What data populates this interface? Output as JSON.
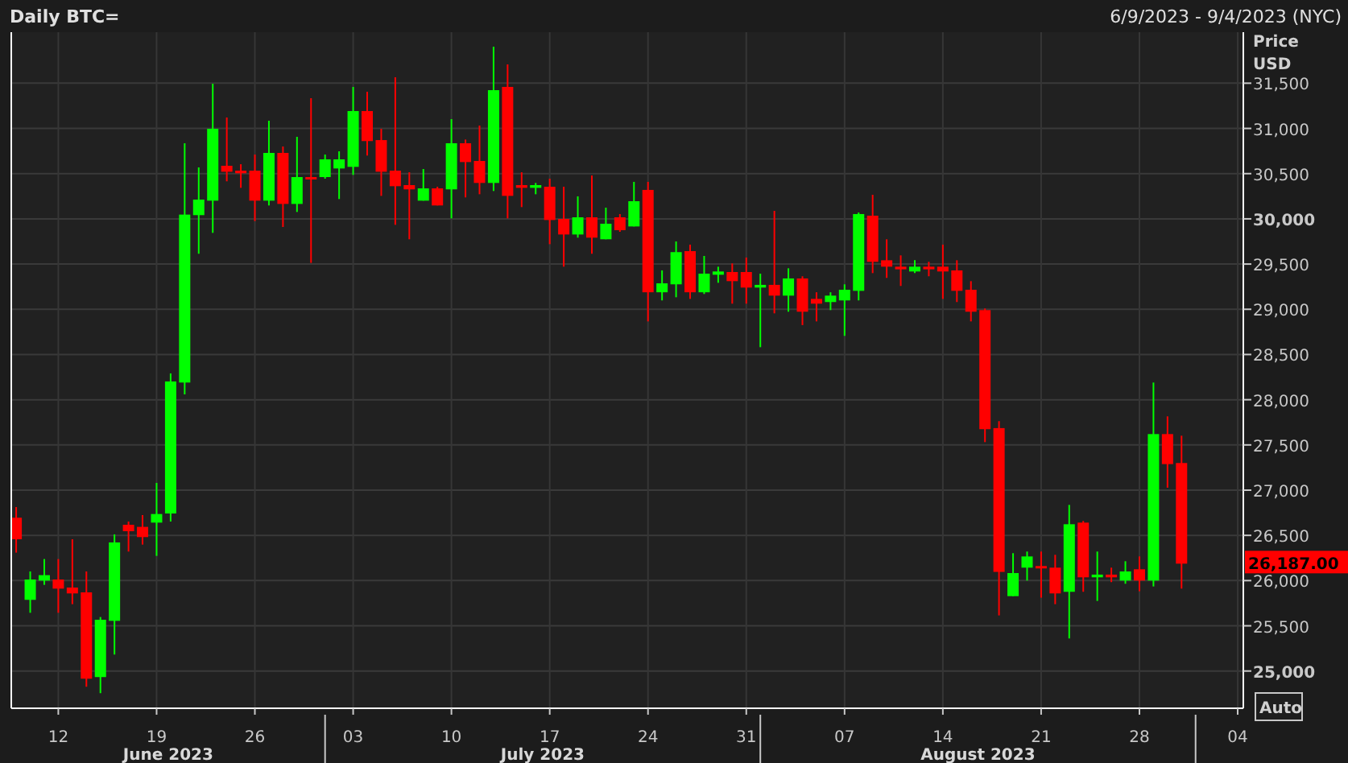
{
  "header": {
    "title": "Daily BTC=",
    "range": "6/9/2023 - 9/4/2023 (NYC)"
  },
  "chart": {
    "chart_data": {
      "type": "candlestick",
      "grid": true,
      "categories": [
        null,
        null,
        null,
        "12",
        null,
        null,
        null,
        null,
        null,
        null,
        "19",
        null,
        null,
        null,
        null,
        null,
        null,
        "26",
        null,
        null,
        null,
        null,
        null,
        null,
        "03",
        null,
        null,
        null,
        null,
        null,
        null,
        "10",
        null,
        null,
        null,
        null,
        null,
        null,
        "17",
        null,
        null,
        null,
        null,
        null,
        null,
        "24",
        null,
        null,
        null,
        null,
        null,
        null,
        "31",
        null,
        null,
        null,
        null,
        null,
        null,
        "07",
        null,
        null,
        null,
        null,
        null,
        null,
        "14",
        null,
        null,
        null,
        null,
        null,
        null,
        "21",
        null,
        null,
        null,
        null,
        null,
        null,
        "28",
        null,
        null,
        null,
        null,
        null,
        null,
        "04"
      ],
      "ohlc": [
        [
          26695,
          26813,
          26309,
          26457
        ],
        [
          25787,
          26101,
          25644,
          26012
        ],
        [
          26000,
          26238,
          25953,
          26060
        ],
        [
          26012,
          26238,
          25644,
          25911
        ],
        [
          25923,
          26457,
          25739,
          25858
        ],
        [
          25870,
          26101,
          24826,
          24915
        ],
        [
          24933,
          25597,
          24755,
          25567
        ],
        [
          25555,
          26511,
          25182,
          26422
        ],
        [
          26617,
          26653,
          26321,
          26546
        ],
        [
          26594,
          26724,
          26398,
          26481
        ],
        [
          26641,
          27080,
          26273,
          26736
        ],
        [
          26742,
          28291,
          26653,
          28202
        ],
        [
          28190,
          30836,
          28059,
          30047
        ],
        [
          30041,
          30569,
          29614,
          30213
        ],
        [
          30201,
          31494,
          29845,
          30996
        ],
        [
          30587,
          31121,
          30415,
          30521
        ],
        [
          30533,
          30604,
          30343,
          30504
        ],
        [
          30533,
          30711,
          29976,
          30201
        ],
        [
          30201,
          31085,
          30148,
          30729
        ],
        [
          30729,
          30800,
          29910,
          30165
        ],
        [
          30165,
          30907,
          30076,
          30462
        ],
        [
          30462,
          31334,
          29513,
          30438
        ],
        [
          30462,
          30711,
          30444,
          30658
        ],
        [
          30557,
          30747,
          30219,
          30658
        ],
        [
          30575,
          31459,
          30486,
          31192
        ],
        [
          31192,
          31405,
          30700,
          30860
        ],
        [
          30871,
          30996,
          30254,
          30521
        ],
        [
          30533,
          31566,
          29934,
          30361
        ],
        [
          30373,
          30515,
          29774,
          30326
        ],
        [
          30201,
          30551,
          30201,
          30337
        ],
        [
          30337,
          30355,
          30148,
          30148
        ],
        [
          30326,
          31103,
          30005,
          30836
        ],
        [
          30836,
          30877,
          30237,
          30628
        ],
        [
          30640,
          31032,
          30272,
          30397
        ],
        [
          30397,
          31904,
          30308,
          31423
        ],
        [
          31459,
          31708,
          30005,
          30254
        ],
        [
          30373,
          30515,
          30130,
          30343
        ],
        [
          30343,
          30397,
          30272,
          30373
        ],
        [
          30355,
          30444,
          29720,
          29987
        ],
        [
          29999,
          30355,
          29471,
          29827
        ],
        [
          29827,
          30249,
          29792,
          30017
        ],
        [
          30017,
          30480,
          29614,
          29792
        ],
        [
          29774,
          30124,
          29774,
          29946
        ],
        [
          30017,
          30053,
          29857,
          29875
        ],
        [
          29916,
          30409,
          29916,
          30195
        ],
        [
          30320,
          30409,
          28866,
          29188
        ],
        [
          29188,
          29430,
          29098,
          29287
        ],
        [
          29276,
          29750,
          29133,
          29632
        ],
        [
          29643,
          29715,
          29115,
          29188
        ],
        [
          29188,
          29590,
          29169,
          29394
        ],
        [
          29382,
          29471,
          29293,
          29418
        ],
        [
          29412,
          29507,
          29062,
          29311
        ],
        [
          29412,
          29572,
          29062,
          29240
        ],
        [
          29240,
          29394,
          28581,
          29270
        ],
        [
          29270,
          30088,
          28955,
          29151
        ],
        [
          29151,
          29453,
          28973,
          29341
        ],
        [
          29341,
          29365,
          28825,
          28973
        ],
        [
          29115,
          29188,
          28866,
          29062
        ],
        [
          29080,
          29188,
          28991,
          29151
        ],
        [
          29098,
          29276,
          28706,
          29216
        ],
        [
          29204,
          30070,
          29098,
          30053
        ],
        [
          30035,
          30266,
          29400,
          29525
        ],
        [
          29542,
          29774,
          29347,
          29471
        ],
        [
          29471,
          29596,
          29258,
          29442
        ],
        [
          29418,
          29542,
          29400,
          29471
        ],
        [
          29471,
          29525,
          29365,
          29442
        ],
        [
          29471,
          29715,
          29115,
          29418
        ],
        [
          29430,
          29542,
          29080,
          29204
        ],
        [
          29216,
          29311,
          28866,
          28973
        ],
        [
          28991,
          29009,
          27531,
          27674
        ],
        [
          27686,
          27763,
          25615,
          26096
        ],
        [
          25828,
          26303,
          25828,
          26083
        ],
        [
          26143,
          26321,
          26000,
          26267
        ],
        [
          26161,
          26321,
          25811,
          26143
        ],
        [
          26143,
          26285,
          25739,
          25858
        ],
        [
          25876,
          26837,
          25360,
          26623
        ],
        [
          26641,
          26659,
          25876,
          26036
        ],
        [
          26036,
          26321,
          25775,
          26066
        ],
        [
          26066,
          26143,
          25983,
          26036
        ],
        [
          26000,
          26214,
          25965,
          26101
        ],
        [
          26125,
          26267,
          25882,
          26000
        ],
        [
          26000,
          28190,
          25935,
          27620
        ],
        [
          27620,
          27816,
          27027,
          27288
        ],
        [
          27300,
          27602,
          25911,
          26187
        ],
        null,
        null,
        null,
        null
      ],
      "ylim": [
        24588,
        32064
      ],
      "yticks": [
        {
          "value": 25000,
          "label": "25,000"
        },
        {
          "value": 25500,
          "label": "25,500"
        },
        {
          "value": 26000,
          "label": "26,000"
        },
        {
          "value": 26500,
          "label": "26,500"
        },
        {
          "value": 27000,
          "label": "27,000"
        },
        {
          "value": 27500,
          "label": "27,500"
        },
        {
          "value": 28000,
          "label": "28,000"
        },
        {
          "value": 28500,
          "label": "28,500"
        },
        {
          "value": 29000,
          "label": "29,000"
        },
        {
          "value": 29500,
          "label": "29,500"
        },
        {
          "value": 30000,
          "label": "30,000"
        },
        {
          "value": 30500,
          "label": "30,500"
        },
        {
          "value": 31000,
          "label": "31,000"
        },
        {
          "value": 31500,
          "label": "31,500"
        }
      ]
    },
    "axis_title": [
      "Price",
      "USD"
    ],
    "current_price": "26,187.00",
    "auto_button": "Auto",
    "months": [
      {
        "label": "June 2023"
      },
      {
        "label": "July 2023"
      },
      {
        "label": "August 2023"
      }
    ]
  }
}
